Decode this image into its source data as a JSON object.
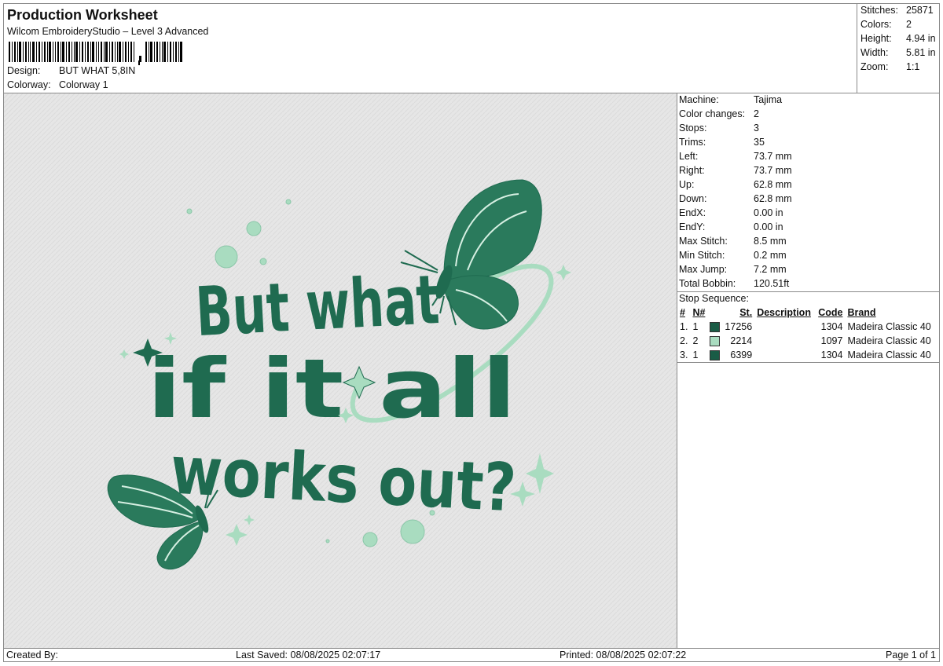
{
  "header": {
    "title": "Production Worksheet",
    "subtitle": "Wilcom EmbroideryStudio – Level 3 Advanced",
    "design_label": "Design:",
    "design_value": "BUT WHAT 5,8IN",
    "colorway_label": "Colorway:",
    "colorway_value": "Colorway 1"
  },
  "stats": {
    "stitches_label": "Stitches:",
    "stitches_value": "25871",
    "colors_label": "Colors:",
    "colors_value": "2",
    "height_label": "Height:",
    "height_value": "4.94 in",
    "width_label": "Width:",
    "width_value": "5.81 in",
    "zoom_label": "Zoom:",
    "zoom_value": "1:1"
  },
  "design_preview": {
    "line1": "But what",
    "line2": "if it all",
    "line3": "works out?",
    "colors": {
      "dark": "#1f6b50",
      "light": "#a9dcc0",
      "background": "#e6e6e6"
    }
  },
  "machine_info": {
    "machine_label": "Machine:",
    "machine_value": "Tajima",
    "color_changes_label": "Color changes:",
    "color_changes_value": "2",
    "stops_label": "Stops:",
    "stops_value": "3",
    "trims_label": "Trims:",
    "trims_value": "35",
    "left_label": "Left:",
    "left_value": "73.7 mm",
    "right_label": "Right:",
    "right_value": "73.7 mm",
    "up_label": "Up:",
    "up_value": "62.8 mm",
    "down_label": "Down:",
    "down_value": "62.8 mm",
    "endx_label": "EndX:",
    "endx_value": "0.00 in",
    "endy_label": "EndY:",
    "endy_value": "0.00 in",
    "max_stitch_label": "Max Stitch:",
    "max_stitch_value": "8.5 mm",
    "min_stitch_label": "Min Stitch:",
    "min_stitch_value": "0.2 mm",
    "max_jump_label": "Max Jump:",
    "max_jump_value": "7.2 mm",
    "total_bobbin_label": "Total Bobbin:",
    "total_bobbin_value": "120.51ft"
  },
  "stop_sequence": {
    "title": "Stop Sequence:",
    "headers": {
      "num": "#",
      "n": "N#",
      "st": "St.",
      "description": "Description",
      "code": "Code",
      "brand": "Brand"
    },
    "rows": [
      {
        "num": "1.",
        "n": "1",
        "color": "#1a5c46",
        "st": "17256",
        "description": "",
        "code": "1304",
        "brand": "Madeira Classic 40"
      },
      {
        "num": "2.",
        "n": "2",
        "color": "#a9dcc0",
        "st": "2214",
        "description": "",
        "code": "1097",
        "brand": "Madeira Classic 40"
      },
      {
        "num": "3.",
        "n": "1",
        "color": "#1a5c46",
        "st": "6399",
        "description": "",
        "code": "1304",
        "brand": "Madeira Classic 40"
      }
    ]
  },
  "footer": {
    "created_by": "Created By:",
    "last_saved": "Last Saved: 08/08/2025 02:07:17",
    "printed": "Printed: 08/08/2025 02:07:22",
    "page": "Page 1 of 1"
  }
}
